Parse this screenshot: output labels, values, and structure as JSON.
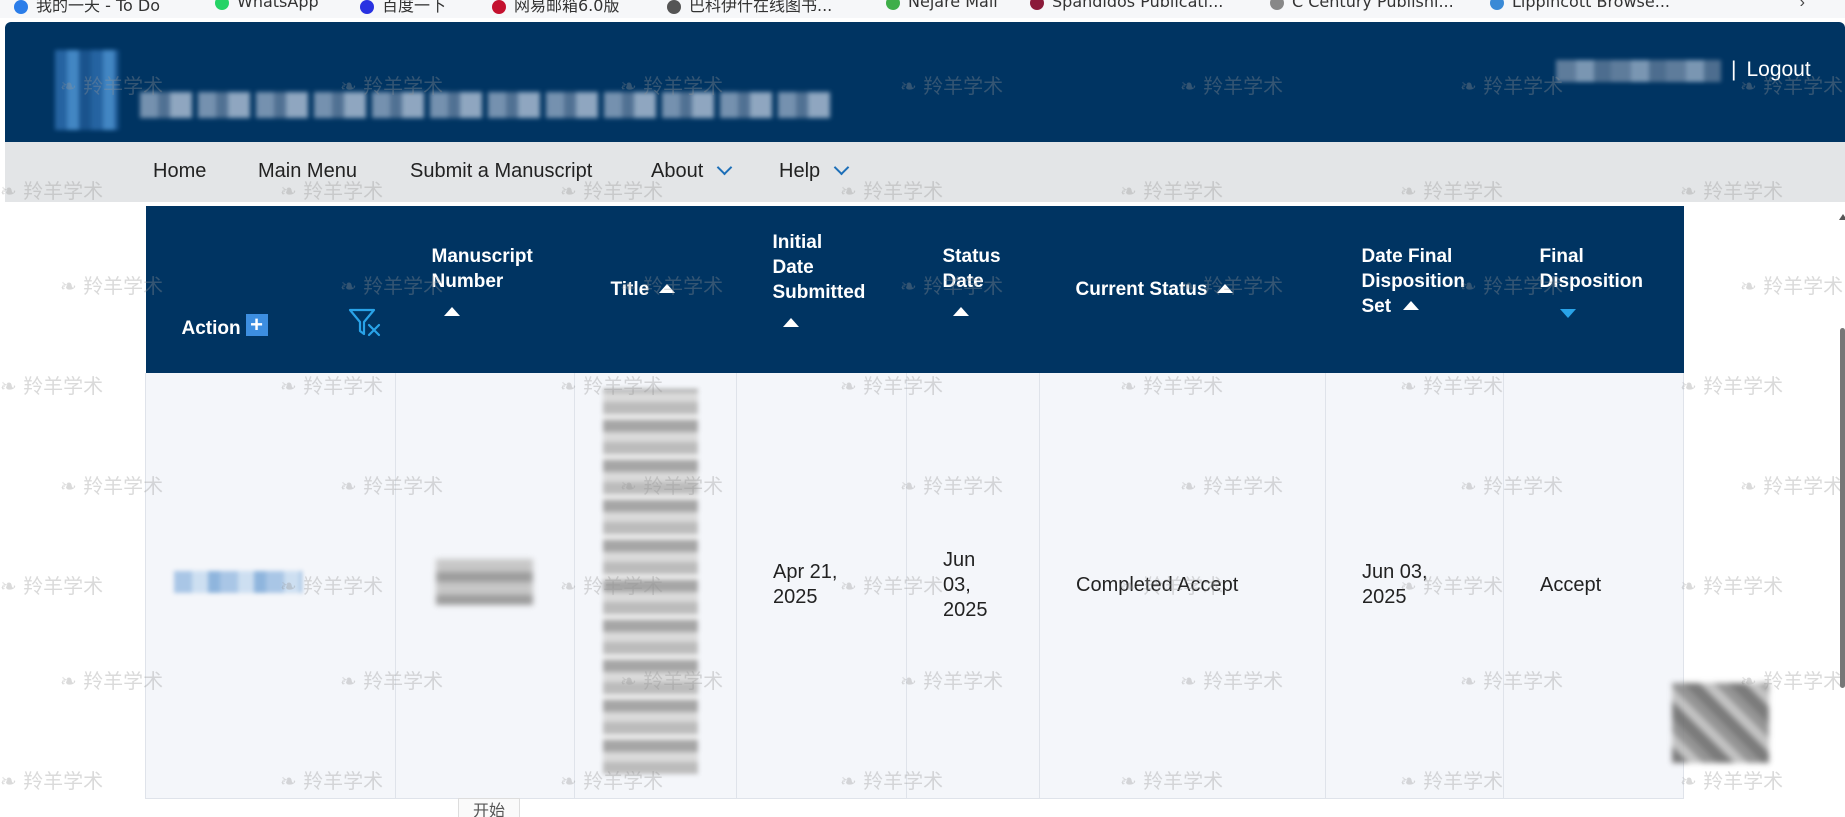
{
  "bookmarks": [
    {
      "label": "我的一天 - To Do",
      "color": "#2b7de9"
    },
    {
      "label": "WhatsApp",
      "color": "#25d366"
    },
    {
      "label": "百度一下",
      "color": "#2932e1"
    },
    {
      "label": "网易邮箱6.0版",
      "color": "#c4112f"
    },
    {
      "label": "巴科伊什在线图书...",
      "color": "#555555"
    },
    {
      "label": "Nejare Mail",
      "color": "#3fae49"
    },
    {
      "label": "Spandidos Publicati...",
      "color": "#8b1a3a"
    },
    {
      "label": "C Century Publishi...",
      "color": "#888888"
    },
    {
      "label": "Lippincott Browse...",
      "color": "#3a8ad6"
    }
  ],
  "bookmarks_more": "›",
  "header": {
    "logout_separator": "|",
    "logout_label": "Logout"
  },
  "nav": {
    "home": "Home",
    "main_menu": "Main Menu",
    "submit": "Submit a Manuscript",
    "about": "About",
    "help": "Help"
  },
  "table": {
    "headers": {
      "action": "Action",
      "action_add": "+",
      "manuscript_number_1": "Manuscript",
      "manuscript_number_2": "Number",
      "title": "Title",
      "initial_date_1": "Initial",
      "initial_date_2": "Date",
      "initial_date_3": "Submitted",
      "status_date_1": "Status",
      "status_date_2": "Date",
      "current_status": "Current Status",
      "date_final_1": "Date Final",
      "date_final_2": "Disposition",
      "date_final_3": "Set",
      "final_disposition_1": "Final",
      "final_disposition_2": "Disposition"
    },
    "rows": [
      {
        "initial_date_1": "Apr 21,",
        "initial_date_2": "2025",
        "status_date_1": "Jun",
        "status_date_2": "03,",
        "status_date_3": "2025",
        "current_status": "Completed Accept",
        "date_final_1": "Jun 03,",
        "date_final_2": "2025",
        "final_disposition": "Accept"
      }
    ]
  },
  "watermark": "羚羊学术",
  "bottom_label": "开始",
  "colors": {
    "header_bg": "#003462",
    "nav_bg": "#e3e5e7",
    "row_bg": "#f4f6fa",
    "accent": "#3d8ee0"
  }
}
